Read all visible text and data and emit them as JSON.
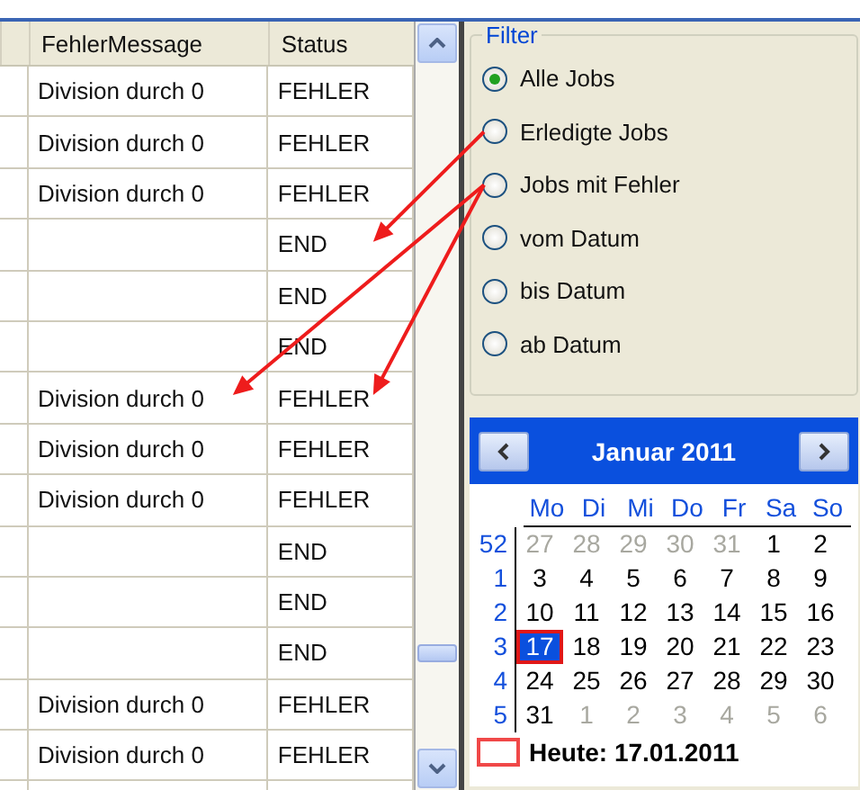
{
  "grid": {
    "columns": [
      "FehlerMessage",
      "Status"
    ],
    "rows": [
      [
        "Division durch 0",
        "FEHLER"
      ],
      [
        "Division durch 0",
        "FEHLER"
      ],
      [
        "Division durch 0",
        "FEHLER"
      ],
      [
        "",
        "END"
      ],
      [
        "",
        "END"
      ],
      [
        "",
        "END"
      ],
      [
        "Division durch 0",
        "FEHLER"
      ],
      [
        "Division durch 0",
        "FEHLER"
      ],
      [
        "Division durch 0",
        "FEHLER"
      ],
      [
        "",
        "END"
      ],
      [
        "",
        "END"
      ],
      [
        "",
        "END"
      ],
      [
        "Division durch 0",
        "FEHLER"
      ],
      [
        "Division durch 0",
        "FEHLER"
      ]
    ]
  },
  "filter": {
    "title": "Filter",
    "options": [
      {
        "label": "Alle Jobs",
        "selected": true
      },
      {
        "label": "Erledigte Jobs",
        "selected": false
      },
      {
        "label": "Jobs mit Fehler",
        "selected": false
      },
      {
        "label": "vom Datum",
        "selected": false
      },
      {
        "label": "bis Datum",
        "selected": false
      },
      {
        "label": "ab Datum",
        "selected": false
      }
    ]
  },
  "calendar": {
    "month": "Januar 2011",
    "weekdays": [
      "Mo",
      "Di",
      "Mi",
      "Do",
      "Fr",
      "Sa",
      "So"
    ],
    "weeks": [
      {
        "number": "52",
        "days": [
          {
            "text": "27",
            "other": true,
            "selected": false
          },
          {
            "text": "28",
            "other": true,
            "selected": false
          },
          {
            "text": "29",
            "other": true,
            "selected": false
          },
          {
            "text": "30",
            "other": true,
            "selected": false
          },
          {
            "text": "31",
            "other": true,
            "selected": false
          },
          {
            "text": "1",
            "other": false,
            "selected": false
          },
          {
            "text": "2",
            "other": false,
            "selected": false
          }
        ]
      },
      {
        "number": "1",
        "days": [
          {
            "text": "3",
            "other": false,
            "selected": false
          },
          {
            "text": "4",
            "other": false,
            "selected": false
          },
          {
            "text": "5",
            "other": false,
            "selected": false
          },
          {
            "text": "6",
            "other": false,
            "selected": false
          },
          {
            "text": "7",
            "other": false,
            "selected": false
          },
          {
            "text": "8",
            "other": false,
            "selected": false
          },
          {
            "text": "9",
            "other": false,
            "selected": false
          }
        ]
      },
      {
        "number": "2",
        "days": [
          {
            "text": "10",
            "other": false,
            "selected": false
          },
          {
            "text": "11",
            "other": false,
            "selected": false
          },
          {
            "text": "12",
            "other": false,
            "selected": false
          },
          {
            "text": "13",
            "other": false,
            "selected": false
          },
          {
            "text": "14",
            "other": false,
            "selected": false
          },
          {
            "text": "15",
            "other": false,
            "selected": false
          },
          {
            "text": "16",
            "other": false,
            "selected": false
          }
        ]
      },
      {
        "number": "3",
        "days": [
          {
            "text": "17",
            "other": false,
            "selected": true
          },
          {
            "text": "18",
            "other": false,
            "selected": false
          },
          {
            "text": "19",
            "other": false,
            "selected": false
          },
          {
            "text": "20",
            "other": false,
            "selected": false
          },
          {
            "text": "21",
            "other": false,
            "selected": false
          },
          {
            "text": "22",
            "other": false,
            "selected": false
          },
          {
            "text": "23",
            "other": false,
            "selected": false
          }
        ]
      },
      {
        "number": "4",
        "days": [
          {
            "text": "24",
            "other": false,
            "selected": false
          },
          {
            "text": "25",
            "other": false,
            "selected": false
          },
          {
            "text": "26",
            "other": false,
            "selected": false
          },
          {
            "text": "27",
            "other": false,
            "selected": false
          },
          {
            "text": "28",
            "other": false,
            "selected": false
          },
          {
            "text": "29",
            "other": false,
            "selected": false
          },
          {
            "text": "30",
            "other": false,
            "selected": false
          }
        ]
      },
      {
        "number": "5",
        "days": [
          {
            "text": "31",
            "other": false,
            "selected": false
          },
          {
            "text": "1",
            "other": true,
            "selected": false
          },
          {
            "text": "2",
            "other": true,
            "selected": false
          },
          {
            "text": "3",
            "other": true,
            "selected": false
          },
          {
            "text": "4",
            "other": true,
            "selected": false
          },
          {
            "text": "5",
            "other": true,
            "selected": false
          },
          {
            "text": "6",
            "other": true,
            "selected": false
          }
        ]
      }
    ],
    "today": "Heute: 17.01.2011"
  }
}
